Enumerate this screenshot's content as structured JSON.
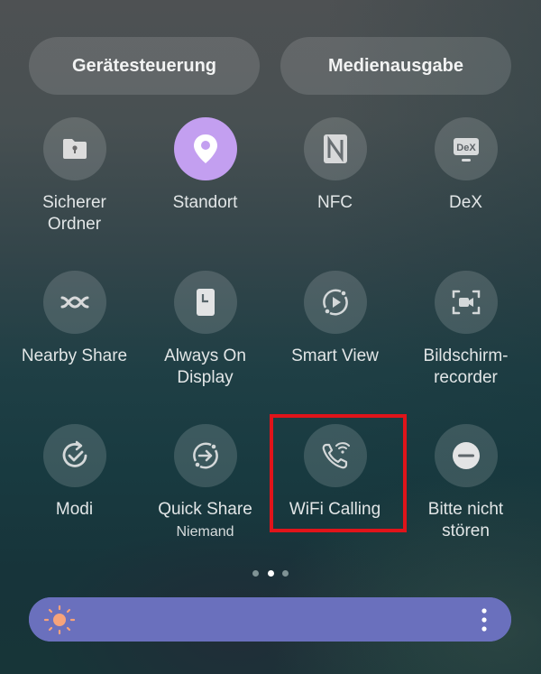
{
  "header": {
    "device_control_label": "Gerätesteuerung",
    "media_output_label": "Medienausgabe"
  },
  "tiles": [
    {
      "label": "Sicherer\nOrdner",
      "icon": "secure-folder-icon",
      "active": false
    },
    {
      "label": "Standort",
      "icon": "location-pin-icon",
      "active": true
    },
    {
      "label": "NFC",
      "icon": "nfc-icon",
      "active": false
    },
    {
      "label": "DeX",
      "icon": "dex-monitor-icon",
      "active": false
    },
    {
      "label": "Nearby Share",
      "icon": "nearby-share-icon",
      "active": false
    },
    {
      "label": "Always On\nDisplay",
      "icon": "always-on-display-icon",
      "active": false
    },
    {
      "label": "Smart View",
      "icon": "smart-view-icon",
      "active": false
    },
    {
      "label": "Bildschirm-\nrecorder",
      "icon": "screen-recorder-icon",
      "active": false
    },
    {
      "label": "Modi",
      "icon": "modes-icon",
      "active": false
    },
    {
      "label": "Quick Share",
      "sublabel": "Niemand",
      "icon": "quick-share-icon",
      "active": false
    },
    {
      "label": "WiFi Calling",
      "icon": "wifi-calling-icon",
      "active": false,
      "highlighted": true
    },
    {
      "label": "Bitte nicht\nstören",
      "icon": "do-not-disturb-icon",
      "active": false
    }
  ],
  "dex_icon_text": "DeX",
  "pagination": {
    "total": 3,
    "current": 2
  },
  "brightness": {
    "level_percent": 100,
    "icon": "sun-icon"
  },
  "colors": {
    "active_tile": "#c39ff0",
    "brightness_bar": "#6a70bd",
    "sun": "#f7a37a",
    "highlight": "#e0141a"
  }
}
